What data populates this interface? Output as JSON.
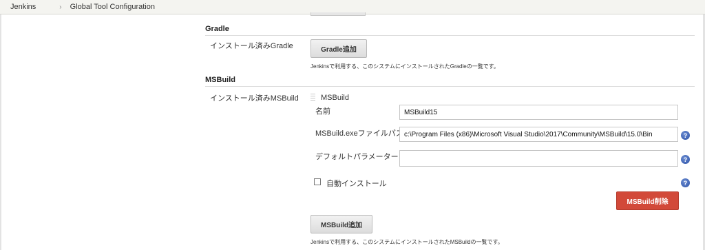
{
  "breadcrumb": {
    "home": "Jenkins",
    "current": "Global Tool Configuration"
  },
  "gradle": {
    "title": "Gradle",
    "installed_label": "インストール済みGradle",
    "add_button": "Gradle追加",
    "help": "Jenkinsで利用する、このシステムにインストールされたGradleの一覧です。"
  },
  "msbuild": {
    "title": "MSBuild",
    "installed_label": "インストール済みMSBuild",
    "item_header": "MSBuild",
    "name_label": "名前",
    "name_value": "MSBuild15",
    "path_label": "MSBuild.exeファイルパス",
    "path_value": "c:\\Program Files (x86)\\Microsoft Visual Studio\\2017\\Community\\MSBuild\\15.0\\Bin",
    "params_label": "デフォルトパラメーター",
    "params_value": "",
    "auto_install_label": "自動インストール",
    "auto_install_checked": false,
    "delete_button": "MSBuild削除",
    "add_button": "MSBuild追加",
    "help": "Jenkinsで利用する、このシステムにインストールされたMSBuildの一覧です。"
  },
  "icons": {
    "help": "?"
  },
  "colors": {
    "delete": "#d24939",
    "help_icon": "#2d53a8"
  }
}
